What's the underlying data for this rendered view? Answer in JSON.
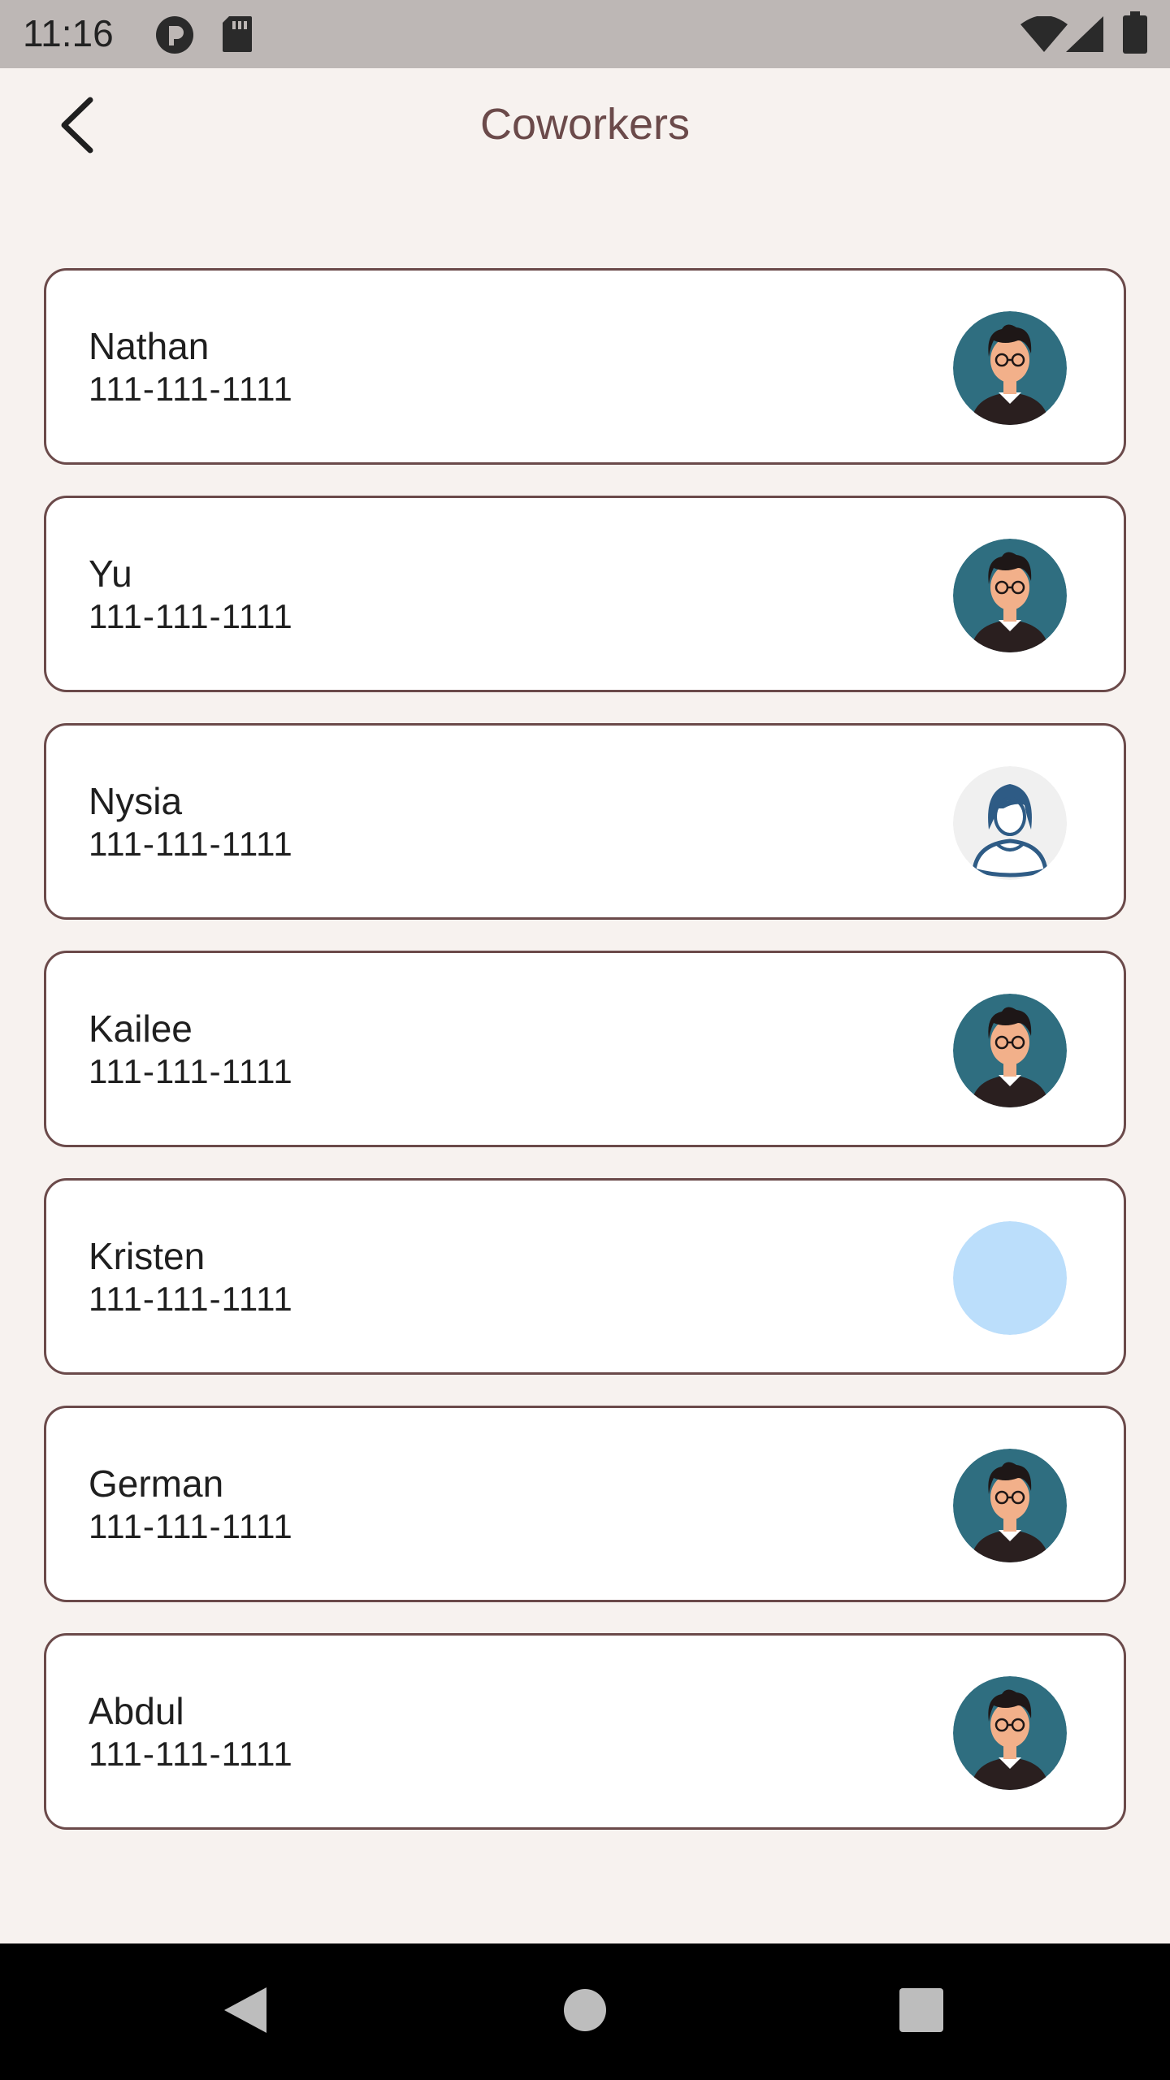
{
  "status_bar": {
    "time": "11:16",
    "icons": [
      "notification-icon",
      "sd-card-icon",
      "wifi-icon",
      "cell-signal-icon",
      "battery-icon"
    ]
  },
  "app_bar": {
    "title": "Coworkers",
    "back_icon": "back-arrow-icon"
  },
  "coworkers": [
    {
      "name": "Nathan",
      "phone": "111-111-1111",
      "avatar": "male-avatar"
    },
    {
      "name": "Yu",
      "phone": "111-111-1111",
      "avatar": "male-avatar"
    },
    {
      "name": "Nysia",
      "phone": "111-111-1111",
      "avatar": "female-avatar"
    },
    {
      "name": "Kailee",
      "phone": "111-111-1111",
      "avatar": "male-avatar"
    },
    {
      "name": "Kristen",
      "phone": "111-111-1111",
      "avatar": "placeholder-avatar"
    },
    {
      "name": "German",
      "phone": "111-111-1111",
      "avatar": "male-avatar"
    },
    {
      "name": "Abdul",
      "phone": "111-111-1111",
      "avatar": "male-avatar"
    }
  ],
  "nav_bar": {
    "icons": [
      "nav-back-icon",
      "nav-home-icon",
      "nav-recents-icon"
    ]
  },
  "colors": {
    "background": "#F7F2EF",
    "accent": "#6B4A4A",
    "avatar_teal": "#2F6E80",
    "placeholder_blue": "#BBDEFB"
  }
}
